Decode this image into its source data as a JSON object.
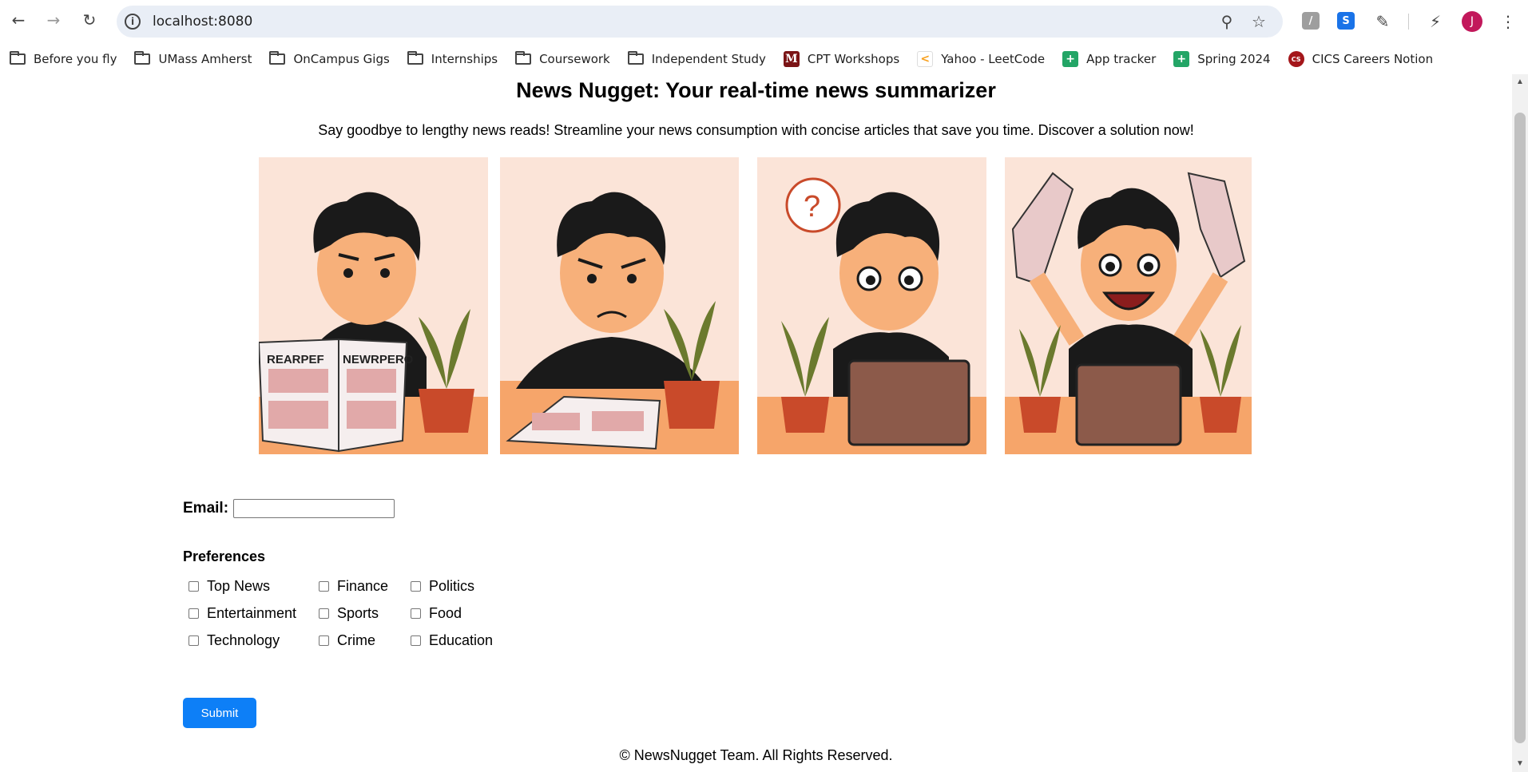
{
  "browser": {
    "url": "localhost:8080",
    "back_icon": "back-arrow-icon",
    "forward_icon": "forward-arrow-icon",
    "reload_icon": "reload-icon",
    "avatar_initial": "J"
  },
  "bookmarks": [
    {
      "label": "Before you fly",
      "icon": "folder-icon"
    },
    {
      "label": "UMass Amherst",
      "icon": "folder-icon"
    },
    {
      "label": "OnCampus Gigs",
      "icon": "folder-icon"
    },
    {
      "label": "Internships",
      "icon": "folder-icon"
    },
    {
      "label": "Coursework",
      "icon": "folder-icon"
    },
    {
      "label": "Independent Study",
      "icon": "folder-icon"
    },
    {
      "label": "CPT Workshops",
      "icon": "m-logo-icon"
    },
    {
      "label": "Yahoo - LeetCode",
      "icon": "leetcode-icon"
    },
    {
      "label": "App tracker",
      "icon": "sheets-icon"
    },
    {
      "label": "Spring 2024",
      "icon": "sheets-icon"
    },
    {
      "label": "CICS Careers Notion",
      "icon": "cics-icon"
    }
  ],
  "page": {
    "title": "News Nugget: Your real-time news summarizer",
    "subtitle": "Say goodbye to lengthy news reads! Streamline your news consumption with concise articles that save you time. Discover a solution now!",
    "comic_panels": [
      {
        "scene": "reading-newspaper",
        "paper_text": "REARPEF NEWRPERO"
      },
      {
        "scene": "frustrated-with-paper",
        "paper_text": ""
      },
      {
        "scene": "thinking-at-laptop",
        "paper_text": ""
      },
      {
        "scene": "celebrating-at-laptop",
        "paper_text": ""
      }
    ],
    "email_label": "Email:",
    "email_value": "",
    "preferences_label": "Preferences",
    "preferences": [
      {
        "label": "Top News",
        "checked": false
      },
      {
        "label": "Finance",
        "checked": false
      },
      {
        "label": "Politics",
        "checked": false
      },
      {
        "label": "Entertainment",
        "checked": false
      },
      {
        "label": "Sports",
        "checked": false
      },
      {
        "label": "Food",
        "checked": false
      },
      {
        "label": "Technology",
        "checked": false
      },
      {
        "label": "Crime",
        "checked": false
      },
      {
        "label": "Education",
        "checked": false
      }
    ],
    "submit_label": "Submit",
    "footer": "© NewsNugget Team. All Rights Reserved."
  },
  "colors": {
    "submit_bg": "#0d7ff7",
    "omnibox_bg": "#e9eef6",
    "avatar_bg": "#c2185b"
  }
}
